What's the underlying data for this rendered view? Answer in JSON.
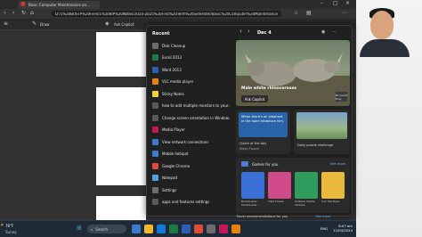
{
  "browser": {
    "tab_title": "Basic Computer Maintenance an...",
    "url": "D:/1%20BUSTP%20Files/1%20BIP%20Notes/2024-2025%20First%20Term%20Semester/Basic%20Computer%20Maintenance%20and%20Best%20Practices.pdf",
    "toolbar": {
      "draw_label": "Draw",
      "ask_copilot_label": "Ask Copilot"
    }
  },
  "start_menu": {
    "recent_title": "Recent",
    "recent_items": [
      {
        "label": "Disk Cleanup",
        "icon": "disk-cleanup-icon",
        "color": "#6b6b6b"
      },
      {
        "label": "Excel 2013",
        "icon": "excel-icon",
        "color": "#1d7a45"
      },
      {
        "label": "Word 2013",
        "icon": "word-icon",
        "color": "#2b5fb4"
      },
      {
        "label": "VLC media player",
        "icon": "vlc-icon",
        "color": "#e8810a"
      },
      {
        "label": "Sticky Notes",
        "icon": "sticky-notes-icon",
        "color": "#f2d13a"
      },
      {
        "label": "how to add multiple monitors to your...",
        "icon": "search-result-icon",
        "color": "#5a5a5a"
      },
      {
        "label": "Change screen orientation in Window...",
        "icon": "search-result-icon",
        "color": "#5a5a5a"
      },
      {
        "label": "Media Player",
        "icon": "media-player-icon",
        "color": "#c2185b"
      },
      {
        "label": "View network connections",
        "icon": "network-icon",
        "color": "#3d7bd1"
      },
      {
        "label": "Mobile hotspot",
        "icon": "hotspot-icon",
        "color": "#3d7bd1"
      },
      {
        "label": "Google Chrome",
        "icon": "chrome-icon",
        "color": "#dd4b39"
      },
      {
        "label": "Notepad",
        "icon": "notepad-icon",
        "color": "#4fa3e0"
      },
      {
        "label": "Settings",
        "icon": "gear-icon",
        "color": "#6d6d6d"
      },
      {
        "label": "apps and features settings",
        "icon": "search-result-icon",
        "color": "#5a5a5a"
      }
    ]
  },
  "feed": {
    "date": "Dec 4",
    "hero": {
      "caption": "Male white rhinoceroses",
      "button_label": "Ask Copilot",
      "logo_text": "Microsoft Bing"
    },
    "quote": {
      "text": "When there's an elephant in the room introduce him.",
      "title": "Quote of the day",
      "author": "Randy Pausch"
    },
    "puzzle": {
      "title": "Daily puzzle challenge"
    },
    "games": {
      "title": "Games for you",
      "see_more": "See more",
      "tiles": [
        {
          "label": "Blockbuster: Adventures ...",
          "color": "#3a6fd8"
        },
        {
          "label": "Tiled Puzzle",
          "color": "#d14a8a"
        },
        {
          "label": "Solitaire Puzzle Venture",
          "color": "#2f9e5d"
        },
        {
          "label": "Cut The Rope",
          "color": "#e8b93a"
        }
      ]
    },
    "travel": {
      "title": "Travel recommendations for you",
      "see_more": "See more"
    }
  },
  "taskbar": {
    "weather_temp": "76°F",
    "weather_desc": "Sunny",
    "search_placeholder": "Search",
    "lang": "ENG",
    "time": "8:07 am",
    "date": "12/04/2024"
  }
}
